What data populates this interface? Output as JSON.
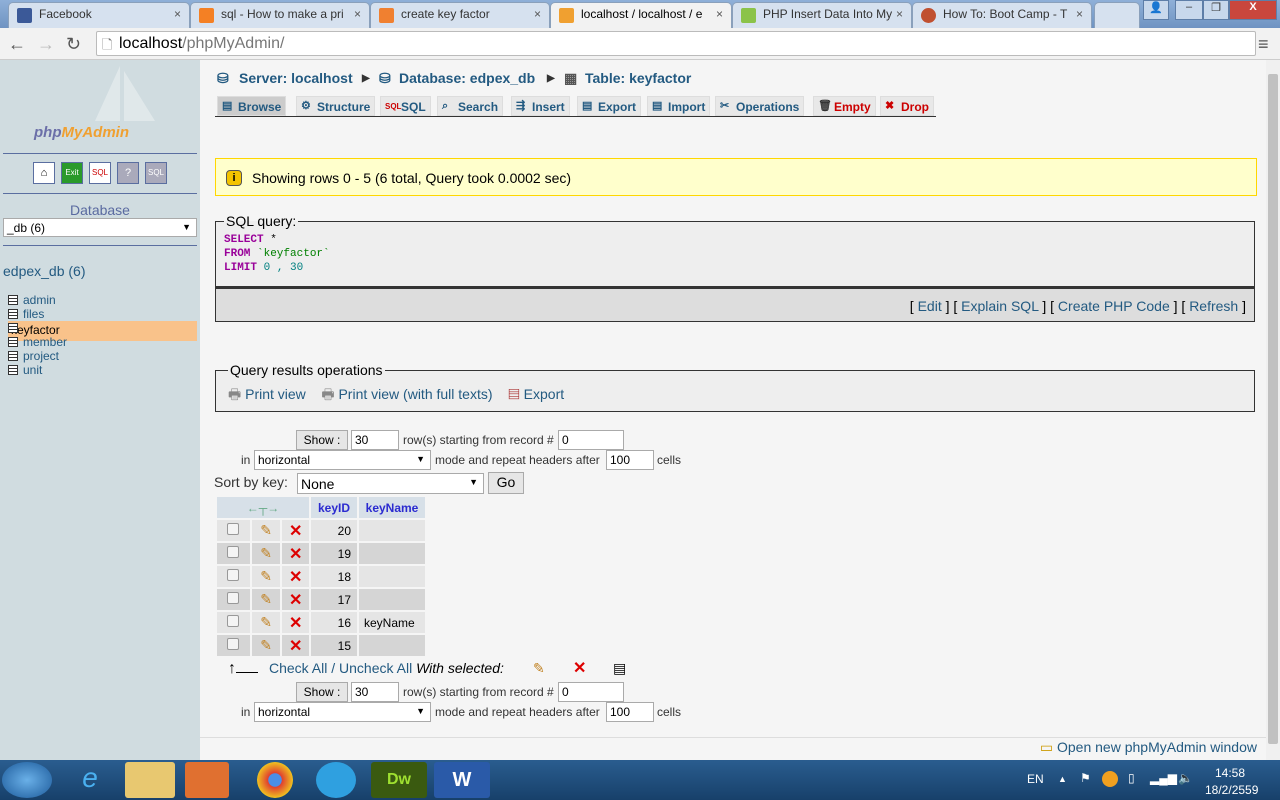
{
  "browser": {
    "tabs": [
      {
        "title": "Facebook",
        "color": "#3b5998"
      },
      {
        "title": "sql - How to make a pri",
        "color": "#f48024"
      },
      {
        "title": "create key factor",
        "color": "#f08030"
      },
      {
        "title": "localhost / localhost / e",
        "color": "#f0a030"
      },
      {
        "title": "PHP Insert Data Into My",
        "color": "#8bc34a"
      },
      {
        "title": "How To: Boot Camp - T",
        "color": "#c05030"
      }
    ],
    "close": "×",
    "url_host": "localhost",
    "url_path": "/phpMyAdmin/"
  },
  "sidebar": {
    "logo_php": "php",
    "logo_my": "MyAdmin",
    "icons": [
      "home-icon",
      "exit-icon",
      "sql-query-icon",
      "help-icon",
      "sql-docs-icon"
    ],
    "db_label": "Database",
    "db_select": "_db (6)",
    "db_title": "edpex_db (6)",
    "tables": [
      "admin",
      "files",
      "keyfactor",
      "member",
      "project",
      "unit"
    ],
    "selected": "keyfactor"
  },
  "breadcrumb": {
    "server": "Server: localhost",
    "database": "Database: edpex_db",
    "table": "Table: keyfactor"
  },
  "tabs": [
    "Browse",
    "Structure",
    "SQL",
    "Search",
    "Insert",
    "Export",
    "Import",
    "Operations",
    "Empty",
    "Drop"
  ],
  "notice": "Showing rows 0 - 5 (6 total, Query took 0.0002 sec)",
  "sql_box": {
    "legend": "SQL query:",
    "select": "SELECT",
    "star": " *",
    "from": "FROM",
    "table": " `keyfactor`",
    "limit": "LIMIT",
    "limit_vals": " 0 , 30",
    "links": {
      "edit": "Edit",
      "explain": "Explain SQL",
      "php": "Create PHP Code",
      "refresh": "Refresh"
    }
  },
  "ops": {
    "legend": "Query results operations",
    "print": "Print view",
    "print_full": "Print view (with full texts)",
    "export": "Export"
  },
  "nav": {
    "show": "Show :",
    "rows": "30",
    "rows_label": "row(s) starting from record #",
    "start": "0",
    "in": "in",
    "mode": "horizontal",
    "mode_label": "mode and repeat headers after",
    "repeat": "100",
    "cells": "cells"
  },
  "sort": {
    "label": "Sort by key:",
    "value": "None",
    "go": "Go"
  },
  "table": {
    "columns": [
      "keyID",
      "keyName"
    ],
    "rows": [
      {
        "id": "20",
        "name": ""
      },
      {
        "id": "19",
        "name": ""
      },
      {
        "id": "18",
        "name": ""
      },
      {
        "id": "17",
        "name": ""
      },
      {
        "id": "16",
        "name": "keyName"
      },
      {
        "id": "15",
        "name": ""
      }
    ]
  },
  "bulk": {
    "check_all": "Check All",
    "sep": " / ",
    "uncheck_all": "Uncheck All",
    "with_selected": "With selected:"
  },
  "footer_link": "Open new phpMyAdmin window",
  "taskbar": {
    "lang": "EN",
    "time": "14:58",
    "date": "18/2/2559"
  }
}
